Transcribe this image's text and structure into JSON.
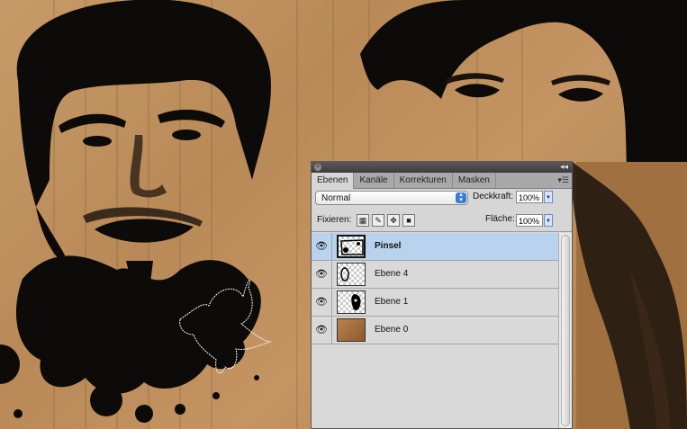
{
  "panel": {
    "tabs": [
      {
        "label": "Ebenen"
      },
      {
        "label": "Kanäle"
      },
      {
        "label": "Korrekturen"
      },
      {
        "label": "Masken"
      }
    ],
    "blend_mode": "Normal",
    "opacity_label": "Deckkraft:",
    "opacity_value": "100%",
    "lock_label": "Fixieren:",
    "fill_label": "Fläche:",
    "fill_value": "100%",
    "layers": [
      {
        "name": "Pinsel",
        "selected": true,
        "visible": true
      },
      {
        "name": "Ebene 4",
        "selected": false,
        "visible": true
      },
      {
        "name": "Ebene 1",
        "selected": false,
        "visible": true
      },
      {
        "name": "Ebene 0",
        "selected": false,
        "visible": true
      }
    ]
  },
  "colors": {
    "cardboard": "#b98a58",
    "ink": "#0d0b09",
    "selected_row": "#b9d3ee",
    "panel_bg": "#d6d6d6"
  },
  "icons": {
    "visibility": "eye-icon",
    "lock_transparent": "checkerboard-lock-icon",
    "lock_image": "brush-lock-icon",
    "lock_position": "move-lock-icon",
    "lock_all": "padlock-icon",
    "panel_menu": "panel-menu-icon",
    "collapse": "double-chevron-icon"
  }
}
